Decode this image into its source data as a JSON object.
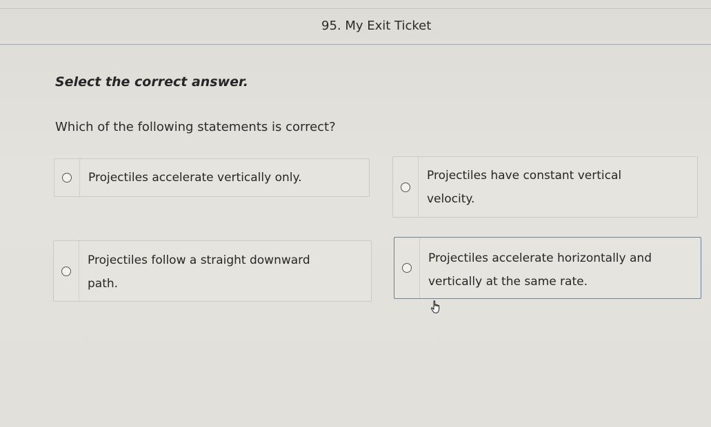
{
  "header": {
    "title": "95. My Exit Ticket"
  },
  "instruction": "Select the correct answer.",
  "question": "Which of the following statements is correct?",
  "options": [
    {
      "id": "a",
      "lines": [
        "Projectiles accelerate vertically only."
      ],
      "selected": false
    },
    {
      "id": "b",
      "lines": [
        "Projectiles have constant vertical",
        "velocity."
      ],
      "selected": false
    },
    {
      "id": "c",
      "lines": [
        "Projectiles follow a straight downward",
        "path."
      ],
      "selected": false
    },
    {
      "id": "d",
      "lines": [
        "Projectiles accelerate horizontally and",
        "vertically at the same rate."
      ],
      "selected": false
    }
  ],
  "cursor": {
    "icon": "hand-pointer-icon"
  }
}
